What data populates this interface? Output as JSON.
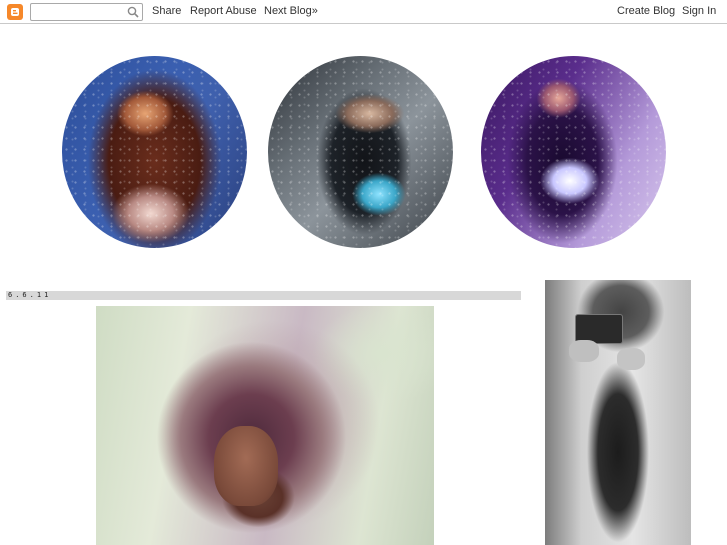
{
  "navbar": {
    "logo_icon": "blogger-icon",
    "search": {
      "value": "",
      "placeholder": "",
      "icon": "search-icon"
    },
    "links": {
      "share": "Share",
      "report_abuse": "Report Abuse",
      "next_blog": "Next Blog»",
      "create_blog": "Create Blog",
      "sign_in": "Sign In"
    },
    "colors": {
      "logo": "#f6882a",
      "border": "#c9c9c9",
      "text": "#333333"
    }
  },
  "header": {
    "images": [
      "header-photo-1",
      "header-photo-2",
      "header-photo-3"
    ]
  },
  "post": {
    "date": "6.6.11",
    "image": "post-photo"
  },
  "sidebar": {
    "image": "sidebar-photo"
  }
}
